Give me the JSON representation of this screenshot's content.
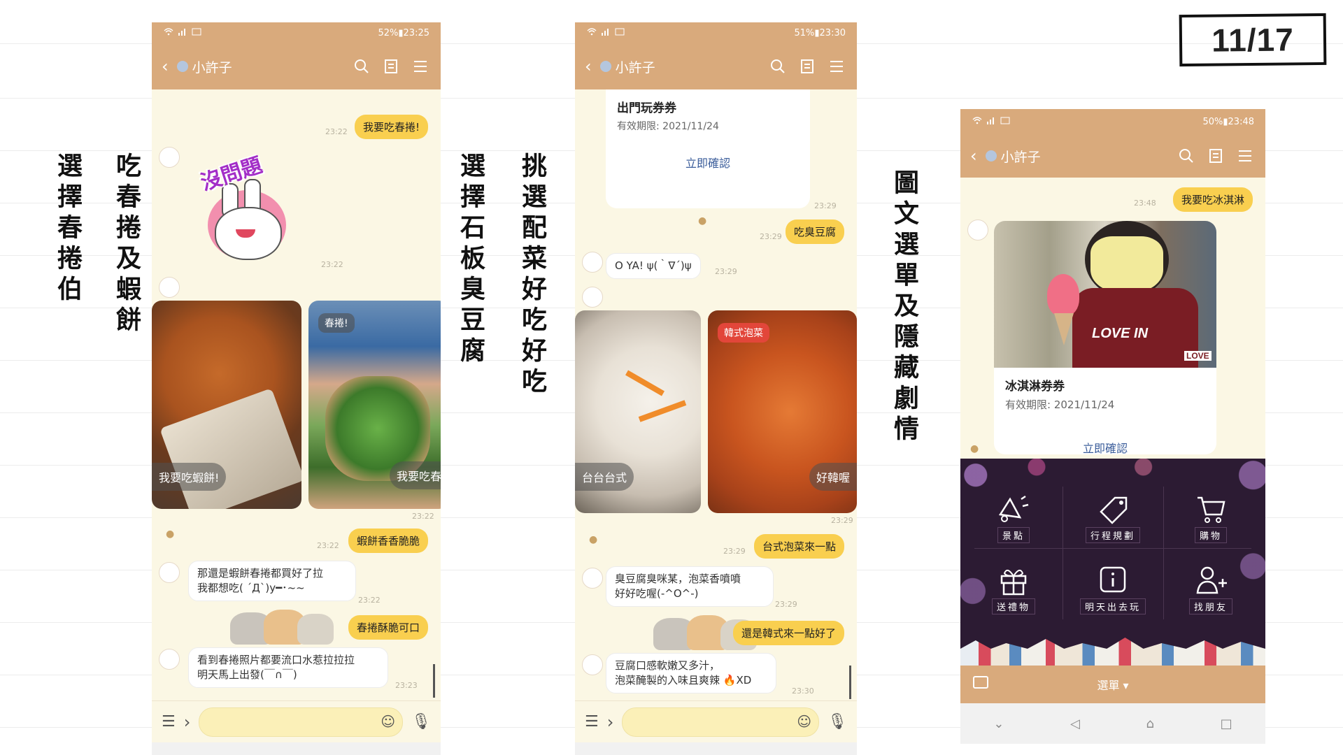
{
  "page_indicator": "11/17",
  "captions": {
    "c1": "選擇春捲伯",
    "c2": "吃春捲及蝦餅",
    "c3": "選擇石板臭豆腐",
    "c4": "挑選配菜好吃好吃",
    "c5": "圖文選單及隱藏劇情"
  },
  "phone1": {
    "status_right": "52%▮23:25",
    "title": "小許子",
    "msgs": {
      "m1": "我要吃春捲!",
      "t1": "23:22",
      "sticker_text": "沒問題",
      "t2": "23:22",
      "card1_caption": "我要吃蝦餅!",
      "card2_tag": "春捲!",
      "card2_caption": "我要吃春",
      "t3": "23:22",
      "m2": "蝦餅香香脆脆",
      "t4": "23:22",
      "r1_line1": "那還是蝦餅春捲都買好了拉",
      "r1_line2": "我都想吃( ´Д`)y━･~~",
      "t5": "23:22",
      "m3": "春捲酥脆可口",
      "r2_line1": "看到春捲照片都要流口水惹拉拉拉",
      "r2_line2": "明天馬上出發(￣∩￣)",
      "t6": "23:23"
    }
  },
  "phone2": {
    "status_right": "51%▮23:30",
    "title": "小許子",
    "msgs": {
      "coupon_title": "出門玩券券",
      "coupon_expiry": "有效期限: 2021/11/24",
      "coupon_btn": "立即確認",
      "t1": "23:29",
      "m1": "吃臭豆腐",
      "t2": "23:29",
      "r1": "O YA! ψ(｀∇´)ψ",
      "t3": "23:29",
      "card1_caption": "台台台式",
      "card2_tag": "韓式泡菜",
      "card2_caption": "好韓喔",
      "t4": "23:29",
      "m2": "台式泡菜來一點",
      "t5": "23:29",
      "r2_line1": "臭豆腐臭咪某，泡菜香噴噴",
      "r2_line2": "好好吃喔(-^O^-)",
      "t6": "23:29",
      "m3": "還是韓式來一點好了",
      "r3_line1": "豆腐口感軟嫩又多汁，",
      "r3_line2": "泡菜醃製的入味且爽辣",
      "r3_tail": "XD",
      "t7": "23:30"
    }
  },
  "phone3": {
    "status_right": "50%▮23:48",
    "title": "小許子",
    "msgs": {
      "t1": "23:48",
      "m1": "我要吃冰淇淋",
      "photo_text": "LOVE IN",
      "photo_text2": "LOVE",
      "coupon_title": "冰淇淋券券",
      "coupon_expiry": "有效期限: 2021/11/24",
      "coupon_btn": "立即確認"
    },
    "menu": {
      "i1": "景點",
      "i2": "行程規劃",
      "i3": "購物",
      "i4": "送禮物",
      "i5": "明天出去玩",
      "i6": "找朋友"
    },
    "menu_toggle": "選單 ▾"
  }
}
